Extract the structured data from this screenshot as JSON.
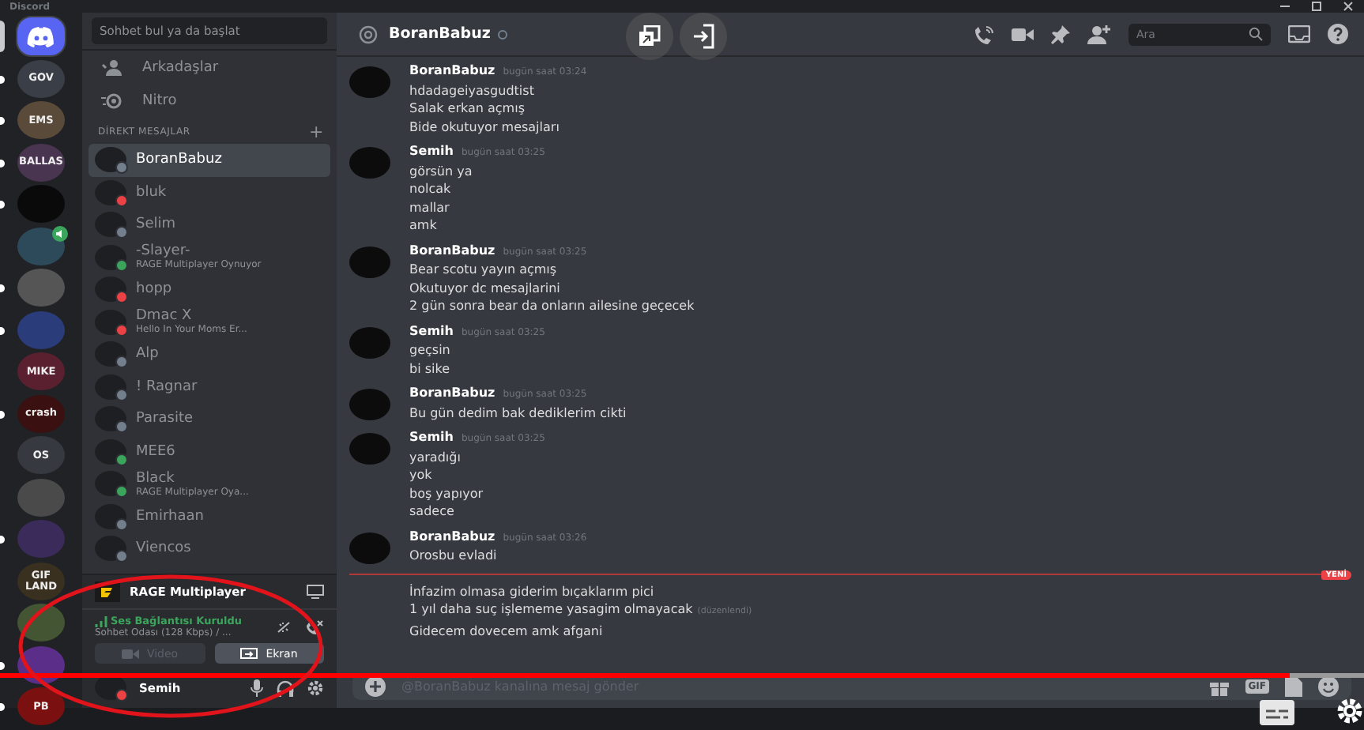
{
  "window": {
    "title": "Discord"
  },
  "servers": [
    {
      "kind": "home",
      "selected": true,
      "unread": false,
      "voice": false
    },
    {
      "kind": "guild",
      "label": "GOV",
      "selected": false,
      "unread": true,
      "voice": false
    },
    {
      "kind": "guild",
      "label": "EMS",
      "selected": false,
      "unread": true,
      "voice": false
    },
    {
      "kind": "guild",
      "label": "BALLAS",
      "selected": false,
      "unread": true,
      "voice": false
    },
    {
      "kind": "guild",
      "selected": false,
      "unread": true,
      "voice": false
    },
    {
      "kind": "guild",
      "selected": false,
      "unread": false,
      "voice": true
    },
    {
      "kind": "guild",
      "selected": false,
      "unread": true,
      "voice": false
    },
    {
      "kind": "guild",
      "selected": false,
      "unread": true,
      "voice": false
    },
    {
      "kind": "guild",
      "label": "MIKE",
      "selected": false,
      "unread": false,
      "voice": false
    },
    {
      "kind": "guild",
      "label": "crash",
      "selected": false,
      "unread": true,
      "voice": false
    },
    {
      "kind": "guild",
      "label": "OS",
      "selected": false,
      "unread": false,
      "voice": false
    },
    {
      "kind": "guild",
      "selected": false,
      "unread": false,
      "voice": false
    },
    {
      "kind": "guild",
      "selected": false,
      "unread": true,
      "voice": false
    },
    {
      "kind": "guild",
      "label": "GIF LAND",
      "selected": false,
      "unread": false,
      "voice": false
    },
    {
      "kind": "guild",
      "selected": false,
      "unread": false,
      "voice": false
    },
    {
      "kind": "guild",
      "selected": false,
      "unread": true,
      "voice": false
    },
    {
      "kind": "guild",
      "label": "PB",
      "selected": false,
      "unread": true,
      "voice": false
    }
  ],
  "sidebar": {
    "search": {
      "placeholder": "Sohbet bul ya da başlat"
    },
    "nav": [
      {
        "kind": "friends",
        "label": "Arkadaşlar"
      },
      {
        "kind": "nitro",
        "label": "Nitro"
      }
    ],
    "section_title": "DİREKT MESAJLAR",
    "section_add": "+",
    "dms": [
      {
        "name": "BoranBabuz",
        "color": "#747f8d",
        "selected": true
      },
      {
        "name": "bluk",
        "color": "#ed4245",
        "selected": false
      },
      {
        "name": "Selim",
        "color": "#747f8d",
        "selected": false
      },
      {
        "name": "-Slayer-",
        "activity": "RAGE Multiplayer Oynuyor",
        "color": "#3ba55c",
        "selected": false
      },
      {
        "name": "hopp",
        "color": "#ed4245",
        "selected": false
      },
      {
        "name": "Dmac X",
        "activity": "Hello In Your Moms Er...",
        "color": "#ed4245",
        "selected": false
      },
      {
        "name": "Alp",
        "color": "#747f8d",
        "selected": false
      },
      {
        "name": "! Ragnar",
        "color": "#747f8d",
        "selected": false
      },
      {
        "name": "Parasite",
        "color": "#747f8d",
        "selected": false
      },
      {
        "name": "MEE6",
        "color": "#3ba55c",
        "selected": false
      },
      {
        "name": "Black",
        "activity": "RAGE Multiplayer Oya...",
        "color": "#3ba55c",
        "selected": false
      },
      {
        "name": "Emirhaan",
        "color": "#747f8d",
        "selected": false
      },
      {
        "name": "Viencos",
        "color": "#747f8d",
        "selected": false
      }
    ],
    "game": {
      "name": "RAGE Multiplayer"
    },
    "voice": {
      "status": "Ses Bağlantısı Kuruldu",
      "channel": "Sohbet Odası (128 Kbps) / ...",
      "buttons": [
        {
          "kind": "video",
          "label": "Video",
          "disabled": true
        },
        {
          "kind": "screen",
          "label": "Ekran",
          "disabled": false
        }
      ]
    },
    "user": {
      "name": "Semih",
      "color": "#ed4245"
    }
  },
  "chat": {
    "header": {
      "name": "BoranBabuz",
      "color": "#747f8d"
    },
    "search": {
      "placeholder": "Ara"
    },
    "messages": [
      {
        "kind": "group",
        "author": "BoranBabuz",
        "time": "bugün saat 03:24",
        "lines": [
          {
            "text": "hdadageiyasgudtist"
          },
          {
            "text": "Salak erkan açmış"
          },
          {
            "text": "Bide okutuyor mesajları"
          }
        ]
      },
      {
        "kind": "group",
        "author": "Semih",
        "time": "bugün saat 03:25",
        "lines": [
          {
            "text": "görsün ya"
          },
          {
            "text": "nolcak"
          },
          {
            "text": "mallar"
          },
          {
            "text": "amk"
          }
        ]
      },
      {
        "kind": "group",
        "author": "BoranBabuz",
        "time": "bugün saat 03:25",
        "lines": [
          {
            "text": "Bear scotu yayın açmış"
          },
          {
            "text": "Okutuyor dc mesajlarini"
          },
          {
            "text": "2 gün sonra bear da onların ailesine geçecek"
          }
        ]
      },
      {
        "kind": "group",
        "author": "Semih",
        "time": "bugün saat 03:25",
        "lines": [
          {
            "text": "geçsin"
          },
          {
            "text": "bi sike"
          }
        ]
      },
      {
        "kind": "group",
        "author": "BoranBabuz",
        "time": "bugün saat 03:25",
        "lines": [
          {
            "text": "Bu gün dedim bak dediklerim cikti"
          }
        ]
      },
      {
        "kind": "group",
        "author": "Semih",
        "time": "bugün saat 03:25",
        "lines": [
          {
            "text": "yaradığı"
          },
          {
            "text": "yok"
          },
          {
            "text": "boş yapıyor"
          },
          {
            "text": "sadece"
          }
        ]
      },
      {
        "kind": "group",
        "author": "BoranBabuz",
        "time": "bugün saat 03:26",
        "lines": [
          {
            "text": "Orosbu evladi"
          }
        ]
      },
      {
        "kind": "divider",
        "label": "YENİ"
      },
      {
        "kind": "lines",
        "lines": [
          {
            "text": "İnfazim olmasa giderim bıçaklarım pici"
          },
          {
            "text": "1 yıl daha suç işlememe yasagim olmayacak",
            "edited": "(düzenlendi)"
          },
          {
            "text": "Gidecem dovecem amk afgani"
          }
        ]
      }
    ],
    "composer": {
      "placeholder": "@BoranBabuz kanalına mesaj gönder",
      "gif": "GIF"
    }
  },
  "video": {
    "progress": {
      "level": 0.945
    }
  }
}
